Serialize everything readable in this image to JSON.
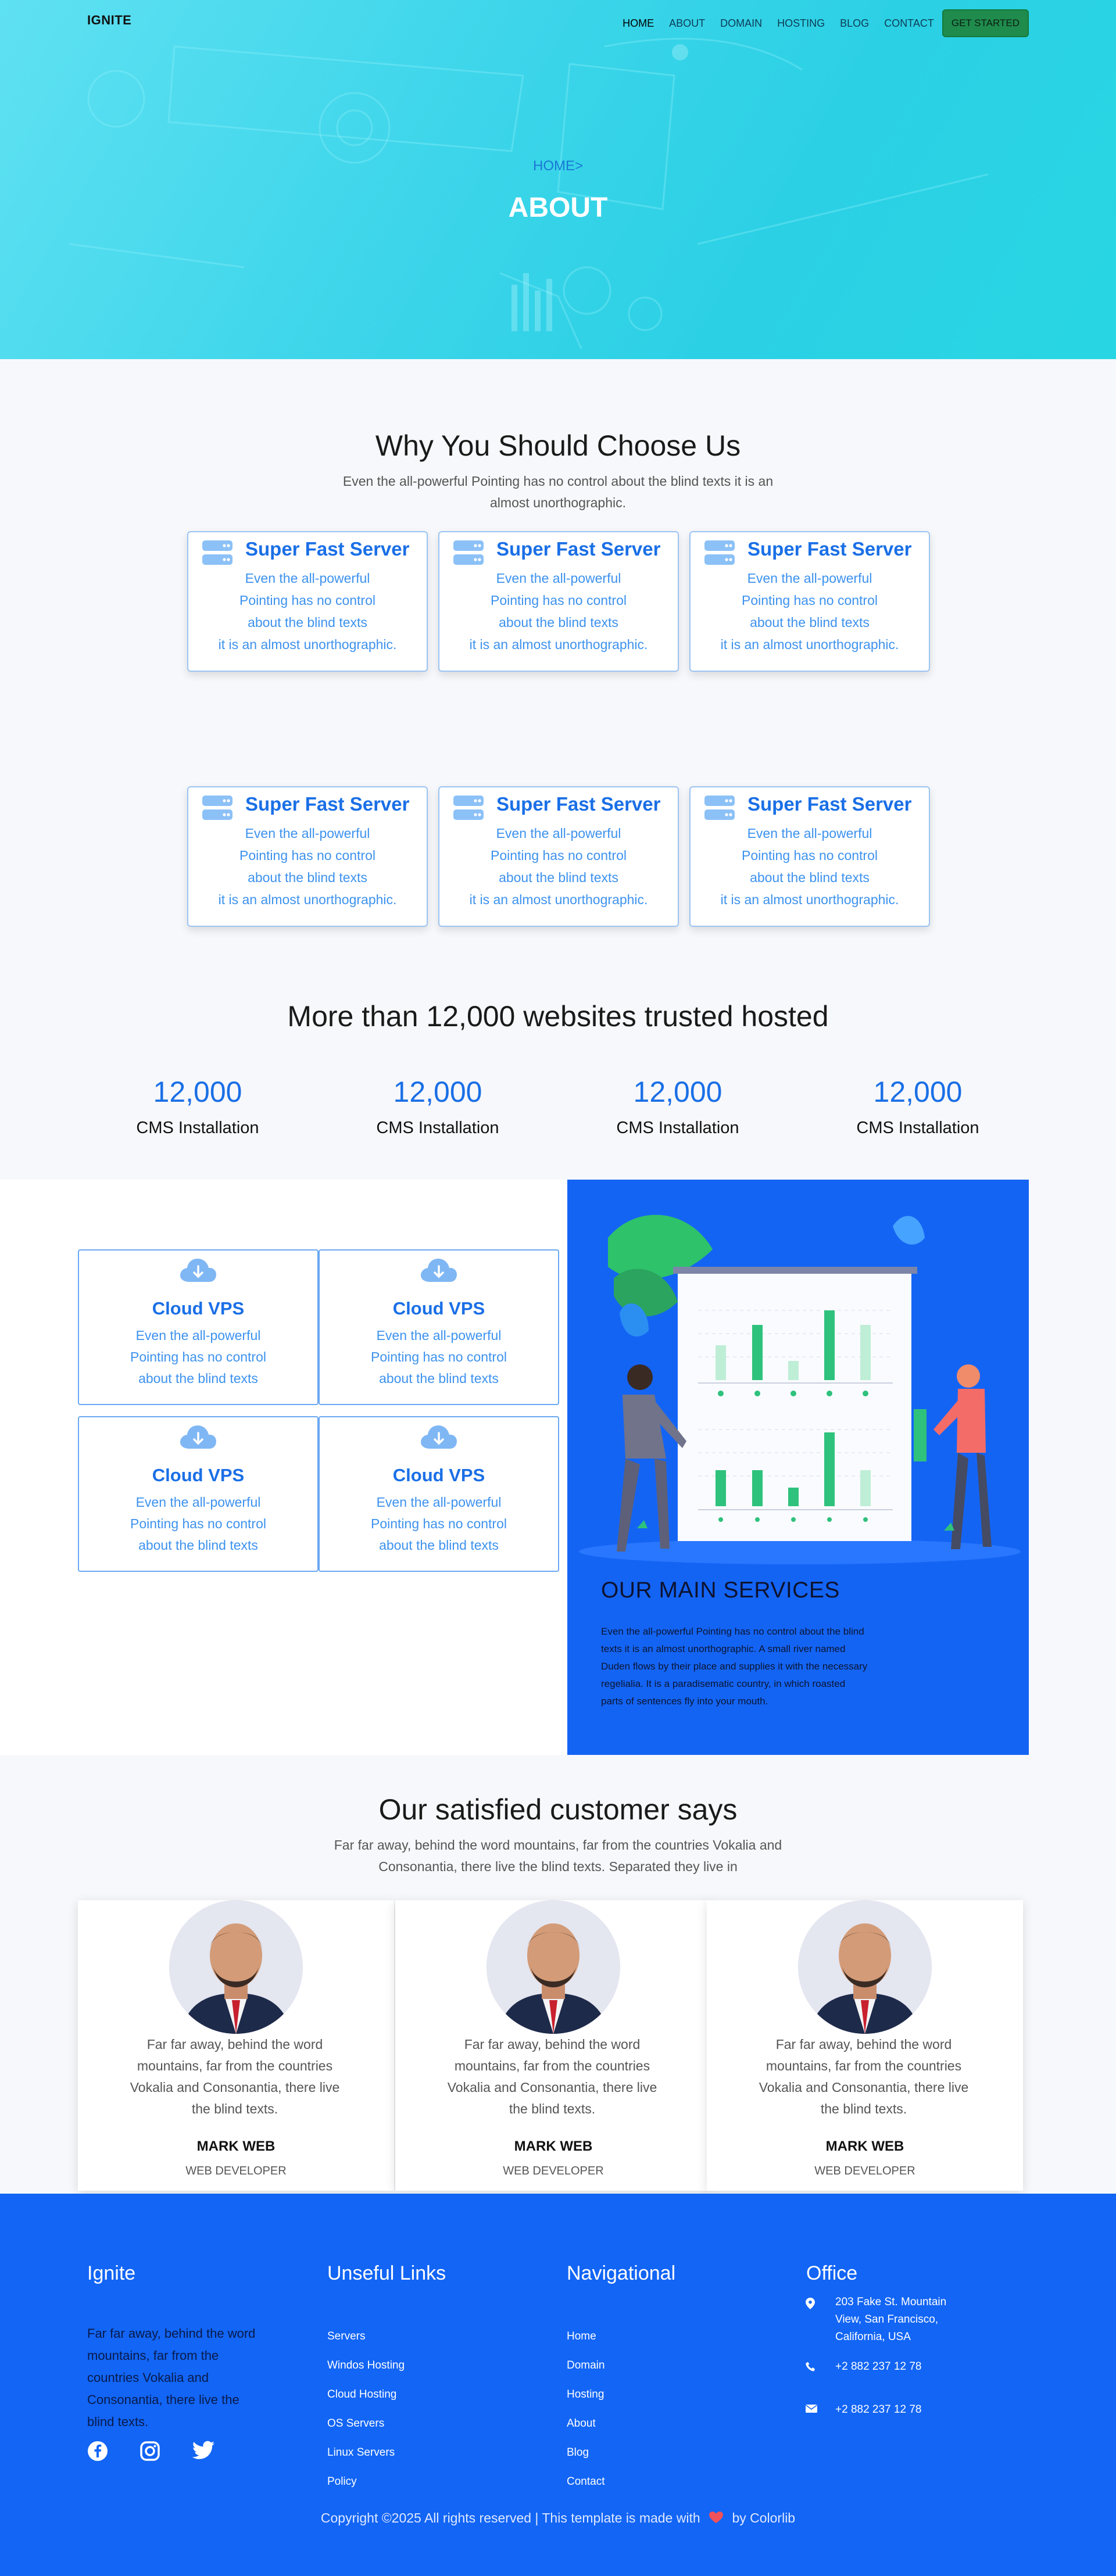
{
  "nav": {
    "brand": "IGNITE",
    "items": [
      "HOME",
      "ABOUT",
      "DOMAIN",
      "HOSTING",
      "BLOG",
      "CONTACT"
    ],
    "cta": "GET STARTED"
  },
  "hero": {
    "breadcrumb": "HOME>",
    "title": "ABOUT"
  },
  "why": {
    "title": "Why You Should Choose Us",
    "subtitle_line1": "Even the all-powerful Pointing has no control about the blind texts it is an",
    "subtitle_line2": "almost unorthographic.",
    "cards": [
      {
        "title": "Super Fast Server",
        "lines": [
          "Even the all-powerful",
          "Pointing has no control",
          "about the blind texts",
          "it is an almost unorthographic."
        ]
      },
      {
        "title": "Super Fast Server",
        "lines": [
          "Even the all-powerful",
          "Pointing has no control",
          "about the blind texts",
          "it is an almost unorthographic."
        ]
      },
      {
        "title": "Super Fast Server",
        "lines": [
          "Even the all-powerful",
          "Pointing has no control",
          "about the blind texts",
          "it is an almost unorthographic."
        ]
      },
      {
        "title": "Super Fast Server",
        "lines": [
          "Even the all-powerful",
          "Pointing has no control",
          "about the blind texts",
          "it is an almost unorthographic."
        ]
      },
      {
        "title": "Super Fast Server",
        "lines": [
          "Even the all-powerful",
          "Pointing has no control",
          "about the blind texts",
          "it is an almost unorthographic."
        ]
      },
      {
        "title": "Super Fast Server",
        "lines": [
          "Even the all-powerful",
          "Pointing has no control",
          "about the blind texts",
          "it is an almost unorthographic."
        ]
      }
    ],
    "card_icon": "server-icon"
  },
  "stats": {
    "title": "More than 12,000 websites trusted hosted",
    "items": [
      {
        "number": "12,000",
        "label": "CMS Installation"
      },
      {
        "number": "12,000",
        "label": "CMS Installation"
      },
      {
        "number": "12,000",
        "label": "CMS Installation"
      },
      {
        "number": "12,000",
        "label": "CMS Installation"
      }
    ]
  },
  "services": {
    "cards": [
      {
        "title": "Cloud VPS",
        "lines": [
          "Even the all-powerful",
          "Pointing has no control",
          "about the blind texts"
        ]
      },
      {
        "title": "Cloud VPS",
        "lines": [
          "Even the all-powerful",
          "Pointing has no control",
          "about the blind texts"
        ]
      },
      {
        "title": "Cloud VPS",
        "lines": [
          "Even the all-powerful",
          "Pointing has no control",
          "about the blind texts"
        ]
      },
      {
        "title": "Cloud VPS",
        "lines": [
          "Even the all-powerful",
          "Pointing has no control",
          "about the blind texts"
        ]
      }
    ],
    "card_icon": "cloud-download-icon",
    "panel_title": "OUR MAIN SERVICES",
    "panel_lines": [
      "Even the all-powerful Pointing has no control about the blind",
      "texts it is an almost unorthographic. A small river named",
      "Duden flows by their place and supplies it with the necessary",
      "regelialia. It is a paradisematic country, in which roasted",
      "parts of sentences fly into your mouth."
    ]
  },
  "testimonials": {
    "title": "Our satisfied customer says",
    "subtitle_line1": "Far far away, behind the word mountains, far from the countries Vokalia and",
    "subtitle_line2": "Consonantia, there live the blind texts. Separated they live in",
    "items": [
      {
        "quote": [
          "Far far away, behind the word",
          "mountains, far from the countries",
          "Vokalia and Consonantia, there live",
          "the blind texts."
        ],
        "name": "MARK WEB",
        "role": "WEB DEVELOPER"
      },
      {
        "quote": [
          "Far far away, behind the word",
          "mountains, far from the countries",
          "Vokalia and Consonantia, there live",
          "the blind texts."
        ],
        "name": "MARK WEB",
        "role": "WEB DEVELOPER"
      },
      {
        "quote": [
          "Far far away, behind the word",
          "mountains, far from the countries",
          "Vokalia and Consonantia, there live",
          "the blind texts."
        ],
        "name": "MARK WEB",
        "role": "WEB DEVELOPER"
      }
    ]
  },
  "footer": {
    "col1": {
      "title": "Ignite",
      "lines": [
        "Far far away, behind the word",
        "mountains, far from the",
        "countries Vokalia and",
        "Consonantia, there live the",
        "blind texts."
      ]
    },
    "social": [
      "facebook-icon",
      "instagram-icon",
      "twitter-icon"
    ],
    "col2": {
      "title": "Unseful Links",
      "links": [
        "Servers",
        "Windos Hosting",
        "Cloud Hosting",
        "OS Servers",
        "Linux Servers",
        "Policy"
      ]
    },
    "col3": {
      "title": "Navigational",
      "links": [
        "Home",
        "Domain",
        "Hosting",
        "About",
        "Blog",
        "Contact"
      ]
    },
    "col4": {
      "title": "Office",
      "address": [
        "203 Fake St. Mountain",
        "View, San Francisco,",
        "California, USA"
      ],
      "phone1": "+2 882 237 12 78",
      "phone2": "+2 882 237 12 78"
    },
    "copyright_pre": "Copyright ©2025 All rights reserved | This template is made with",
    "copyright_post": "by Colorlib"
  },
  "colors": {
    "accent": "#1a6fe6",
    "footer_bg": "#1265f5",
    "cta_bg": "#1f8b4c",
    "hero_bg": "#3dd5ea"
  }
}
